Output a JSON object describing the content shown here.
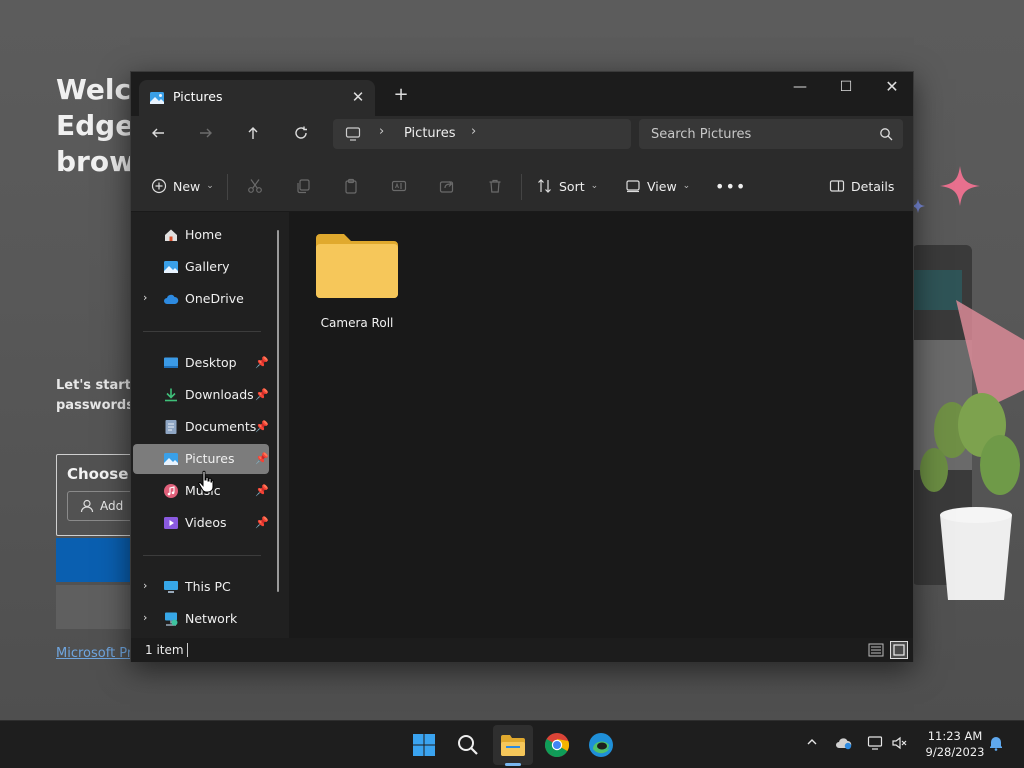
{
  "background": {
    "welcome_text": "Welco\nEdge,\nbrows",
    "start_text": "Let's start b\npasswords,",
    "card_title": "Choose a",
    "add_button": "Add",
    "link": "Microsoft Pr"
  },
  "window": {
    "tab_title": "Pictures",
    "address_segment": "Pictures",
    "search_placeholder": "Search Pictures",
    "toolbar": {
      "new_label": "New",
      "sort_label": "Sort",
      "view_label": "View",
      "details_label": "Details"
    },
    "nav": {
      "home": "Home",
      "gallery": "Gallery",
      "onedrive": "OneDrive",
      "desktop": "Desktop",
      "downloads": "Downloads",
      "documents": "Documents",
      "pictures": "Pictures",
      "music": "Music",
      "videos": "Videos",
      "this_pc": "This PC",
      "network": "Network"
    },
    "items": [
      {
        "name": "Camera Roll",
        "type": "folder"
      }
    ],
    "status": "1 item"
  },
  "taskbar": {
    "time": "11:23 AM",
    "date": "9/28/2023"
  },
  "colors": {
    "folder": "#f6c75a",
    "accent": "#0078d4",
    "selected_nav": "#7c7c7c"
  }
}
